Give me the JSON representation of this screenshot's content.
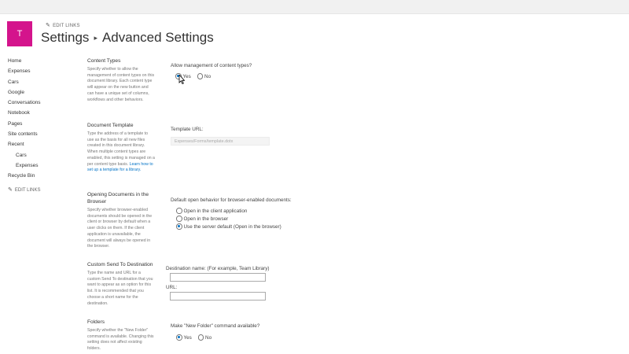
{
  "header": {
    "logo_letter": "T",
    "edit_links": "EDIT LINKS",
    "breadcrumb_root": "Settings",
    "breadcrumb_separator": "▸",
    "breadcrumb_current": "Advanced Settings"
  },
  "leftnav": {
    "items": [
      "Home",
      "Expenses",
      "Cars",
      "Google",
      "Conversations",
      "Notebook",
      "Pages",
      "Site contents",
      "Recent"
    ],
    "recent_items": [
      "Cars",
      "Expenses"
    ],
    "recycle_bin": "Recycle Bin",
    "edit_links": "EDIT LINKS"
  },
  "sections": {
    "content_types": {
      "title": "Content Types",
      "description": "Specify whether to allow the management of content types on this document library. Each content type will appear on the new button and can have a unique set of columns, workflows and other behaviors.",
      "question": "Allow management of content types?",
      "yes": "Yes",
      "no": "No"
    },
    "document_template": {
      "title": "Document Template",
      "description": "Type the address of a template to use as the basis for all new files created in this document library. When multiple content types are enabled, this setting is managed on a per content type basis.",
      "link": "Learn how to set up a template for a library.",
      "url_label": "Template URL:",
      "url_value": "Expenses/Forms/template.dotx"
    },
    "opening_documents": {
      "title": "Opening Documents in the Browser",
      "description": "Specify whether browser-enabled documents should be opened in the client or browser by default when a user clicks on them. If the client application is unavailable, the document will always be opened in the browser.",
      "question": "Default open behavior for browser-enabled documents:",
      "options": [
        "Open in the client application",
        "Open in the browser",
        "Use the server default (Open in the browser)"
      ]
    },
    "send_to": {
      "title": "Custom Send To Destination",
      "description": "Type the name and URL for a custom Send To destination that you want to appear as an option for this list. It is recommended that you choose a short name for the destination.",
      "name_label": "Destination name: (For example, Team Library)",
      "url_label": "URL:"
    },
    "folders": {
      "title": "Folders",
      "description": "Specify whether the \"New Folder\" command is available. Changing this setting does not affect existing folders.",
      "question": "Make \"New Folder\" command available?",
      "yes": "Yes",
      "no": "No"
    }
  }
}
